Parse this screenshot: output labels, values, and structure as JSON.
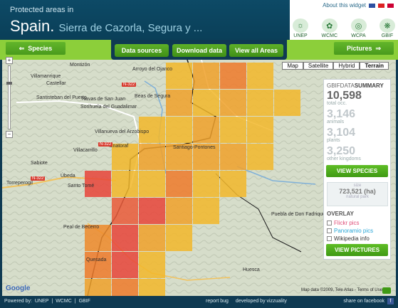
{
  "header": {
    "subtitle": "Protected areas in",
    "country": "Spain.",
    "place": "Sierra de Cazorla, Segura y ...",
    "about_link": "About this widget",
    "logos": [
      "UNEP",
      "WCMC",
      "WCPA",
      "GBIF"
    ]
  },
  "toolbar": {
    "species": "Species",
    "data_sources": "Data sources",
    "download_data": "Download data",
    "view_all_areas": "View all Areas",
    "pictures": "Pictures"
  },
  "map": {
    "types": [
      "Map",
      "Satellite",
      "Hybrid",
      "Terrain"
    ],
    "active_type": "Terrain",
    "attribution": "Map data ©2009, Tele Atlas - Terms of Use",
    "google": "Google",
    "places": [
      {
        "name": "Montizón",
        "key": "Montizón"
      },
      {
        "name": "Arroyo del Ojanco",
        "key": "Arroyo"
      },
      {
        "name": "Villamanrique",
        "key": "Villa"
      },
      {
        "name": "Castellar",
        "key": "Castellar"
      },
      {
        "name": "Santisteban del Puerto",
        "key": "Santisteban"
      },
      {
        "name": "Navas de San Juan",
        "key": "Navas"
      },
      {
        "name": "Sorihuela del Guadalimar",
        "key": "Sorihuela"
      },
      {
        "name": "Beas de Segura",
        "key": "Beas"
      },
      {
        "name": "Villanueva del Arzobispo",
        "key": "Villanueva"
      },
      {
        "name": "Villacarrillo",
        "key": "Villacarrillo"
      },
      {
        "name": "Iznatoraf",
        "key": "Iznatoraf"
      },
      {
        "name": "Sabiote",
        "key": "Sabiote"
      },
      {
        "name": "Torreperogil",
        "key": "Torreperogil"
      },
      {
        "name": "Úbeda",
        "key": "Ubeda"
      },
      {
        "name": "Santo Tomé",
        "key": "Santo"
      },
      {
        "name": "Peal de Becerro",
        "key": "Peal"
      },
      {
        "name": "Quesada",
        "key": "Quesada"
      },
      {
        "name": "Huesca",
        "key": "Huesca"
      },
      {
        "name": "Puebla de Don Fadrique",
        "key": "Puebla"
      },
      {
        "name": "Santiago-Pontones",
        "key": "Santiago"
      }
    ],
    "roads": [
      "N-322",
      "N-322",
      "N-322"
    ]
  },
  "panel": {
    "title_prefix": "GBIFDATA",
    "title_suffix": "SUMMARY",
    "total_value": "10,598",
    "total_label": "total occ.",
    "animals_value": "3,146",
    "animals_label": "animals",
    "plants_value": "3,104",
    "plants_label": "plants",
    "other_value": "3,250",
    "other_label": "other kingdoms",
    "view_species": "VIEW SPECIES",
    "size_label": "size",
    "size_value": "723,521 (ha)",
    "size_sub": "natural park",
    "overlay_title": "OVERLAY",
    "overlays": [
      {
        "label": "Flickr pics",
        "color": "#e0507a"
      },
      {
        "label": "Panoramio pics",
        "color": "#2aa6d6"
      },
      {
        "label": "Wikipedia info",
        "color": "#333333"
      }
    ],
    "view_pictures": "VIEW PICTURES"
  },
  "footer": {
    "powered": "Powered by:",
    "partners": [
      "UNEP",
      "WCMC",
      "GBIF"
    ],
    "report_bug": "report bug",
    "developed_by": "developed by vizzuality",
    "share": "share on facebook"
  }
}
